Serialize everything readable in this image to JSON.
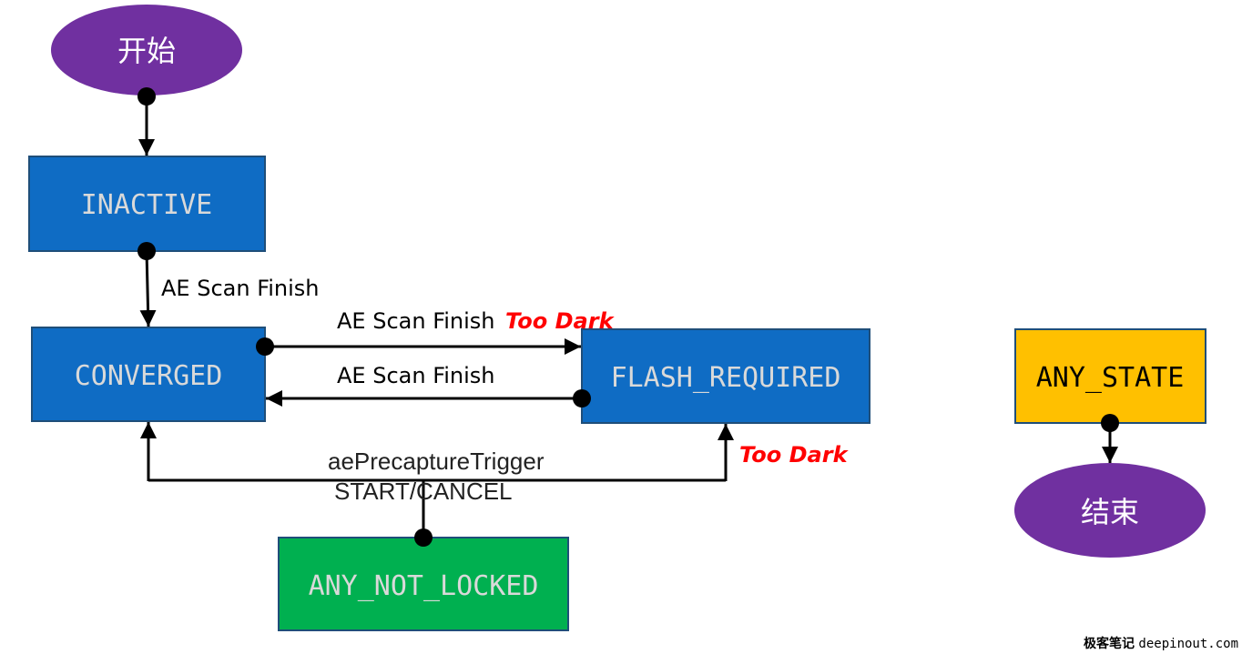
{
  "nodes": {
    "start": {
      "label": "开始",
      "color": "#7030A0"
    },
    "inactive": {
      "label": "INACTIVE",
      "color": "#0F6CC4"
    },
    "converged": {
      "label": "CONVERGED",
      "color": "#0F6CC4"
    },
    "flash_required": {
      "label": "FLASH_REQUIRED",
      "color": "#0F6CC4"
    },
    "any_state": {
      "label": "ANY_STATE",
      "color": "#FFC000"
    },
    "end": {
      "label": "结束",
      "color": "#7030A0"
    },
    "any_not_locked": {
      "label": "ANY_NOT_LOCKED",
      "color": "#00B050"
    }
  },
  "edges": {
    "inactive_to_converged": "AE Scan Finish",
    "converged_to_flash": {
      "label": "AE Scan Finish",
      "condition": "Too Dark"
    },
    "flash_to_converged": "AE Scan Finish",
    "any_not_locked_trigger": {
      "line1": "aePrecaptureTrigger",
      "line2": "START/CANCEL",
      "condition": "Too Dark"
    }
  },
  "watermark": {
    "cn": "极客笔记",
    "en": "deepinout.com"
  }
}
